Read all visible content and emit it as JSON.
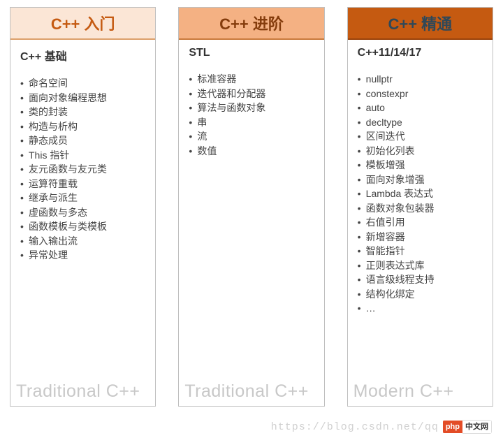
{
  "columns": [
    {
      "title": "C++ 入门",
      "subtitle": "C++ 基础",
      "items": [
        "命名空间",
        "面向对象编程思想",
        "类的封装",
        "构造与析构",
        "静态成员",
        "This 指针",
        "友元函数与友元类",
        "运算符重载",
        "继承与派生",
        "虚函数与多态",
        "函数模板与类模板",
        "输入输出流",
        "异常处理"
      ],
      "footer": "Traditional C++"
    },
    {
      "title": "C++ 进阶",
      "subtitle": "STL",
      "items": [
        "标准容器",
        "迭代器和分配器",
        "算法与函数对象",
        "串",
        "流",
        "数值"
      ],
      "footer": "Traditional C++"
    },
    {
      "title": "C++ 精通",
      "subtitle": "C++11/14/17",
      "items": [
        "nullptr",
        "constexpr",
        "auto",
        "decltype",
        "区间迭代",
        "初始化列表",
        "模板增强",
        "面向对象增强",
        "Lambda 表达式",
        "函数对象包装器",
        "右值引用",
        "新增容器",
        "智能指针",
        "正则表达式库",
        "语言级线程支持",
        "结构化绑定",
        "…"
      ],
      "footer": "Modern C++"
    }
  ],
  "watermark": {
    "text": "https://blog.csdn.net/qq",
    "badge_left": "php",
    "badge_right": "中文网"
  }
}
